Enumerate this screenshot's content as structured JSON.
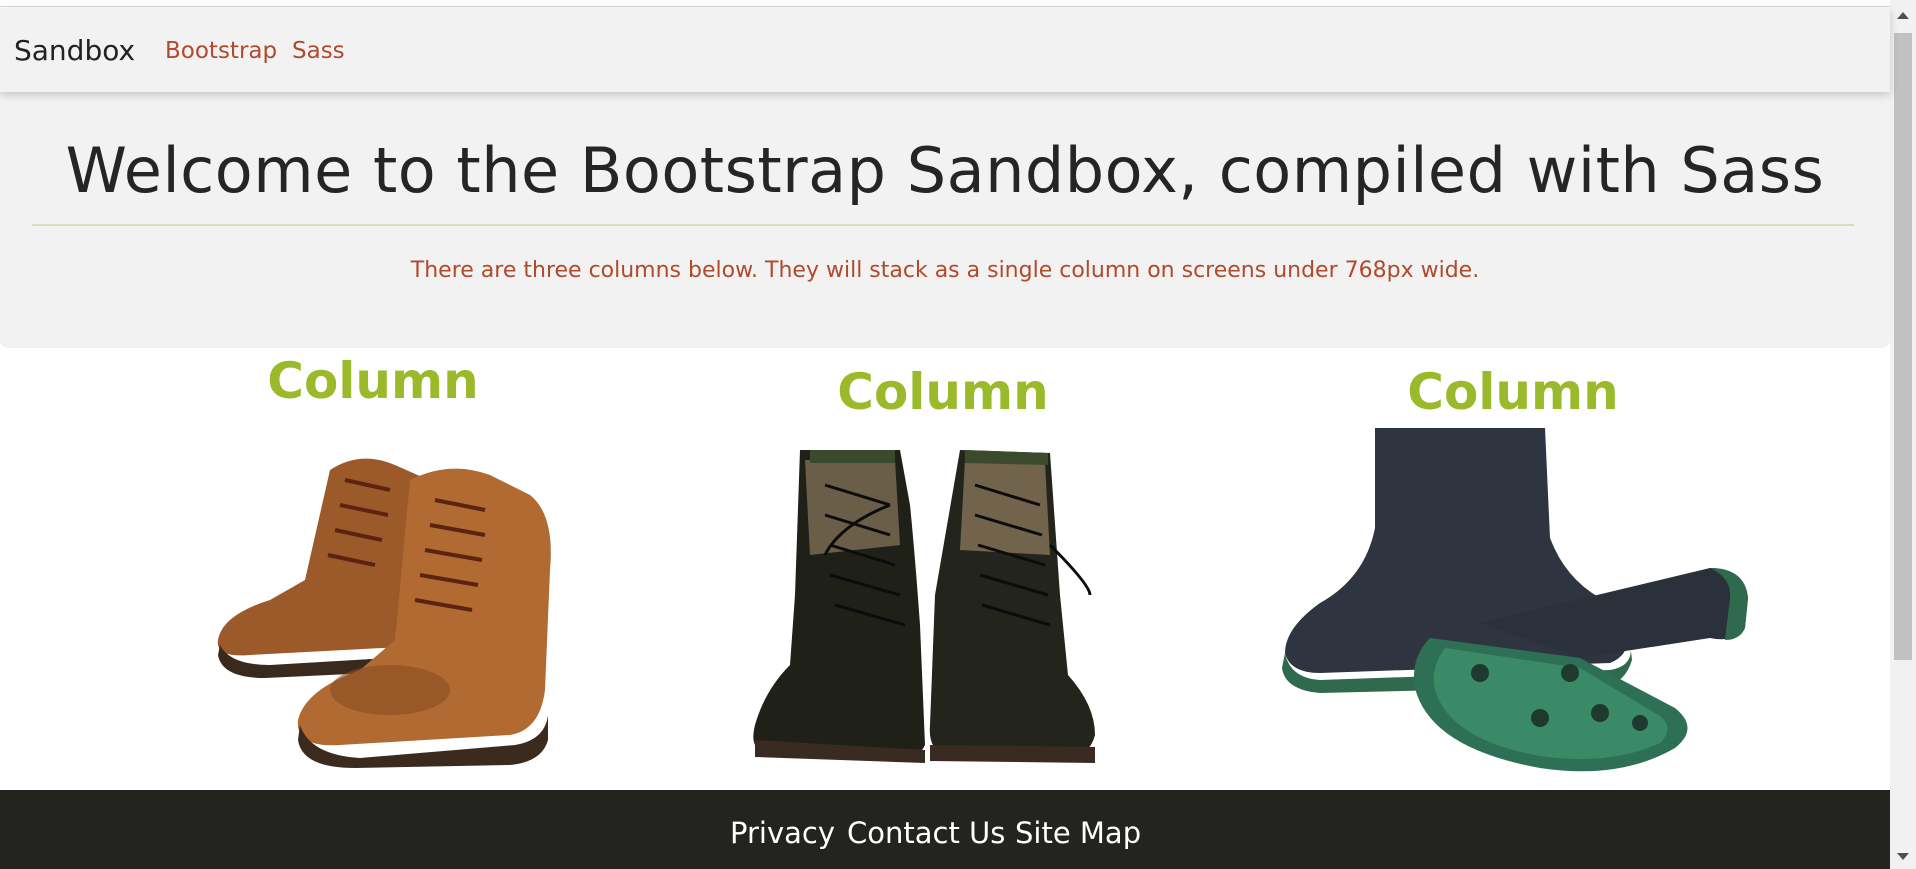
{
  "nav": {
    "brand": "Sandbox",
    "links": [
      {
        "label": "Bootstrap"
      },
      {
        "label": "Sass"
      }
    ]
  },
  "hero": {
    "title": "Welcome to the Bootstrap Sandbox, compiled with Sass",
    "lead": "There are three columns below. They will stack as a single column on screens under 768px wide."
  },
  "columns": [
    {
      "title": "Column",
      "image": "brown-leather-boots"
    },
    {
      "title": "Column",
      "image": "black-combat-boots"
    },
    {
      "title": "Column",
      "image": "rubber-rain-boots"
    }
  ],
  "footer": {
    "links": [
      {
        "label": "Privacy"
      },
      {
        "label": "Contact Us"
      },
      {
        "label": "Site Map"
      }
    ]
  },
  "colors": {
    "link": "#b04a2c",
    "heading_green": "#9ab92b",
    "footer_bg": "#232320",
    "panel_bg": "#f2f2f2"
  }
}
